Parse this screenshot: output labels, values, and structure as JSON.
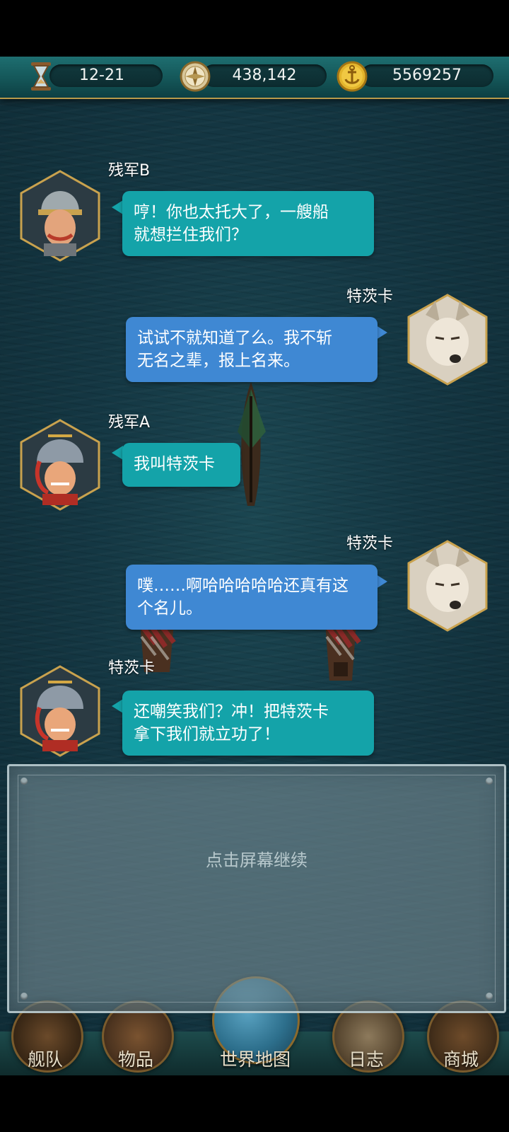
{
  "resources": {
    "date": "12-21",
    "silver": "438,142",
    "gold": "5569257",
    "icons": [
      "hourglass-icon",
      "compass-icon",
      "anchor-coin-icon"
    ]
  },
  "dialogue": [
    {
      "speaker": "残军B",
      "side": "left",
      "text_line1": "哼！你也太托大了，一艘船",
      "text_line2": "就想拦住我们？"
    },
    {
      "speaker": "特茨卡",
      "side": "right",
      "text_line1": "试试不就知道了么。我不斩",
      "text_line2": "无名之辈，报上名来。"
    },
    {
      "speaker": "残军A",
      "side": "left",
      "text_line1": "我叫特茨卡",
      "text_line2": ""
    },
    {
      "speaker": "特茨卡",
      "side": "right",
      "text_line1": "噗……啊哈哈哈哈哈还真有这",
      "text_line2": "个名儿。"
    },
    {
      "speaker": "特茨卡",
      "side": "left",
      "text_line1": "还嘲笑我们？冲！把特茨卡",
      "text_line2": "拿下我们就立功了！"
    }
  ],
  "panel": {
    "prompt": "点击屏幕继续"
  },
  "nav": [
    {
      "label": "舰队",
      "icon": "ship-wheel-icon"
    },
    {
      "label": "物品",
      "icon": "satchel-icon"
    },
    {
      "label": "世界地图",
      "icon": "globe-icon"
    },
    {
      "label": "日志",
      "icon": "scroll-icon"
    },
    {
      "label": "商城",
      "icon": "treasure-chest-icon"
    }
  ],
  "colors": {
    "bubble_teal": "#14a3a9",
    "bubble_blue": "#3f88d3",
    "sea": "#143743",
    "topbar": "#145658"
  }
}
